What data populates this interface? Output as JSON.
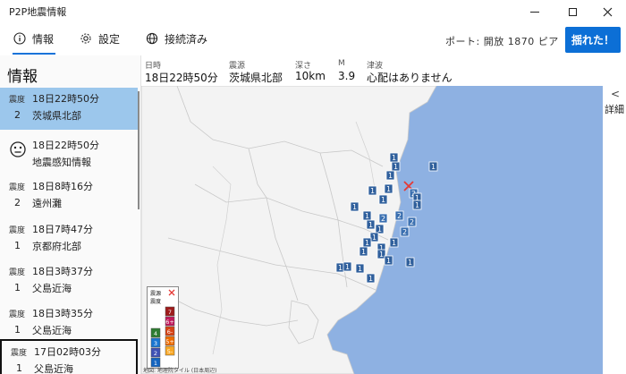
{
  "window": {
    "title": "P2P地震情報"
  },
  "toolbar": {
    "tabs": [
      {
        "label": "情報",
        "icon": "info-icon"
      },
      {
        "label": "設定",
        "icon": "gear-icon"
      },
      {
        "label": "接続済み",
        "icon": "globe-icon"
      }
    ],
    "port_text": "ポート: 開放  1870 ピア",
    "shake_button": "揺れた！"
  },
  "sidebar": {
    "title": "情報",
    "items": [
      {
        "type": "quake",
        "label": "震度",
        "intensity": "2",
        "time": "18日22時50分",
        "place": "茨城県北部",
        "selected": true
      },
      {
        "type": "detect",
        "time": "18日22時50分",
        "place": "地震感知情報"
      },
      {
        "type": "quake",
        "label": "震度",
        "intensity": "2",
        "time": "18日8時16分",
        "place": "遠州灘"
      },
      {
        "type": "quake",
        "label": "震度",
        "intensity": "1",
        "time": "18日7時47分",
        "place": "京都府北部"
      },
      {
        "type": "quake",
        "label": "震度",
        "intensity": "1",
        "time": "18日3時37分",
        "place": "父島近海"
      },
      {
        "type": "quake",
        "label": "震度",
        "intensity": "1",
        "time": "18日3時35分",
        "place": "父島近海"
      },
      {
        "type": "quake",
        "label": "震度",
        "intensity": "1",
        "time": "17日02時03分",
        "place": "父島近海"
      }
    ]
  },
  "detail": {
    "headers": {
      "datetime": "日時",
      "epicenter": "震源",
      "depth": "深さ",
      "magnitude": "M",
      "tsunami": "津波"
    },
    "values": {
      "datetime": "18日22時50分",
      "epicenter": "茨城県北部",
      "depth": "10km",
      "magnitude": "3.9",
      "tsunami": "心配はありません"
    }
  },
  "map": {
    "epicenter_marker": "×",
    "stations": [
      "1",
      "1",
      "1",
      "1",
      "1",
      "1",
      "1",
      "1",
      "2",
      "1",
      "1",
      "2",
      "2",
      "2",
      "2",
      "1",
      "1",
      "1",
      "1",
      "1",
      "1",
      "1",
      "1",
      "1",
      "1",
      "1",
      "1",
      "1",
      "1",
      "1"
    ],
    "legend": {
      "epicenter_label": "震源",
      "intensity_label": "震度",
      "items": [
        "7",
        "6+",
        "6-",
        "5+",
        "5-",
        "4",
        "3",
        "2",
        "1"
      ]
    },
    "attribution": "地図: 地理院タイル (日本周辺)",
    "colors": {
      "sea": "#8eb1e2",
      "land": "#f3f3f3",
      "marker": "#e53935",
      "station": "#3b6ea8"
    }
  },
  "right_panel": {
    "chevron": "<",
    "label": "詳細"
  }
}
